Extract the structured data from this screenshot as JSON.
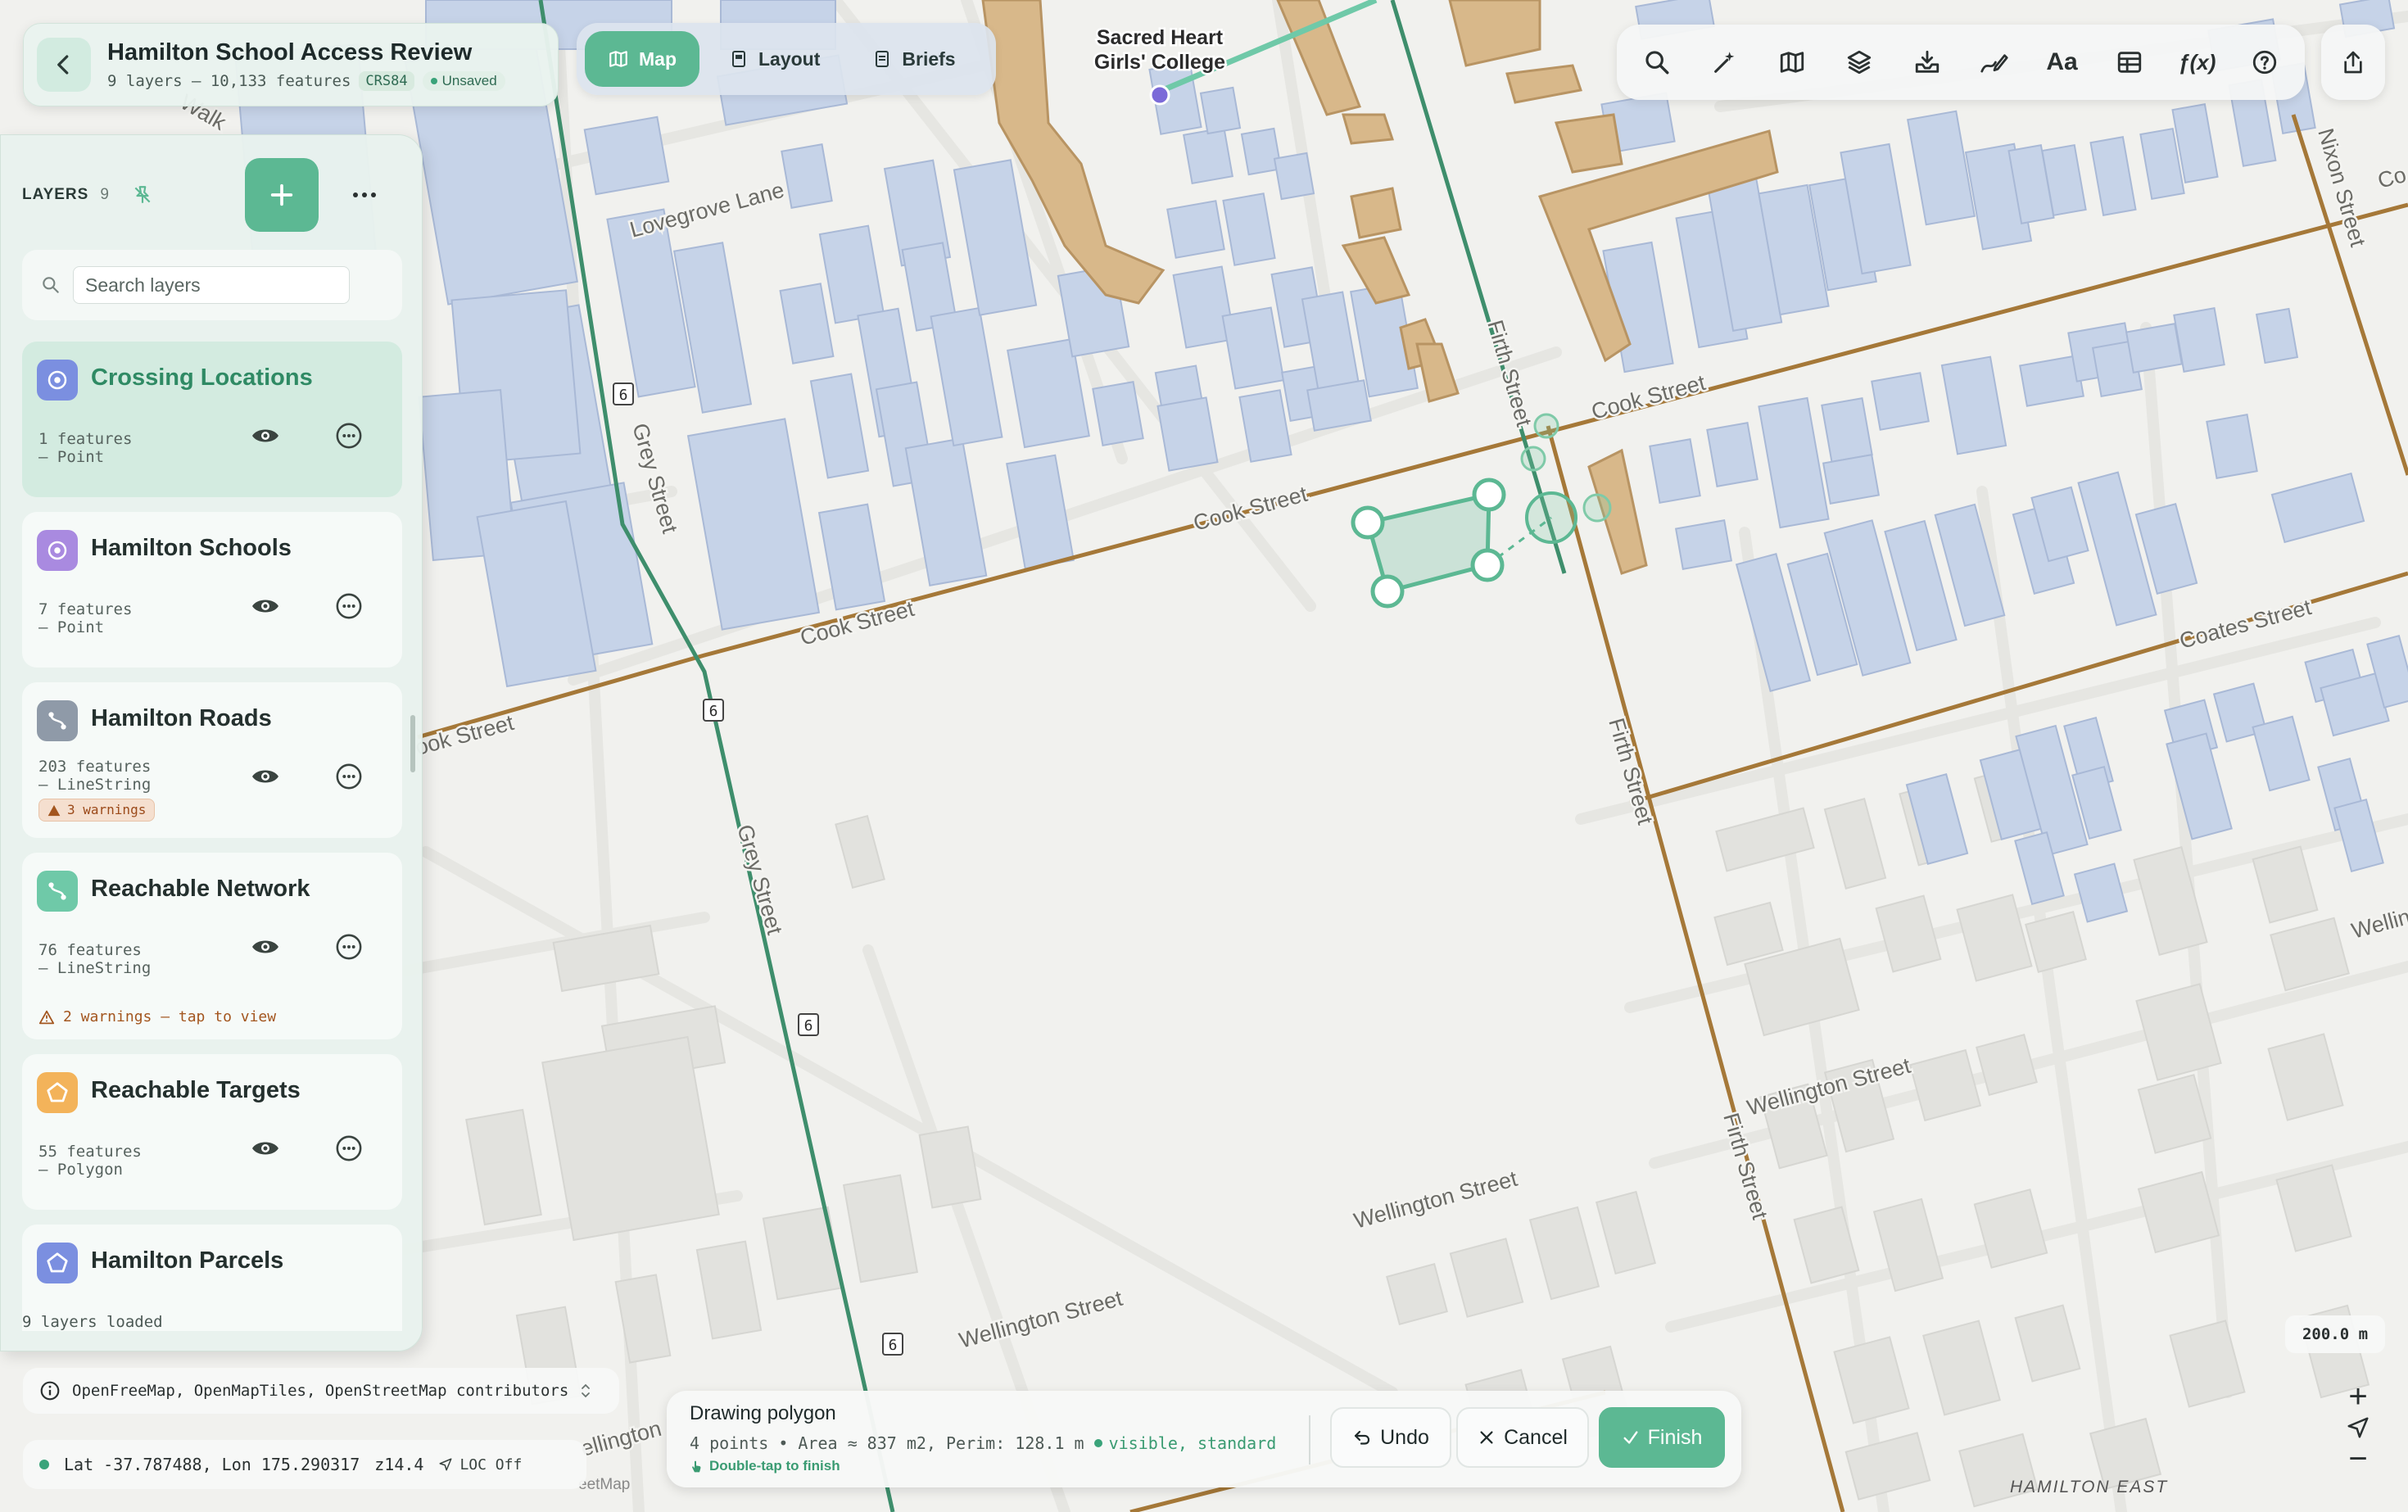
{
  "header": {
    "title": "Hamilton School Access Review",
    "subtitle": "9 layers — 10,133 features",
    "crs": "CRS84",
    "save_status": "Unsaved"
  },
  "view_tabs": [
    {
      "label": "Map",
      "icon": "map-icon",
      "active": true
    },
    {
      "label": "Layout",
      "icon": "layout-icon",
      "active": false
    },
    {
      "label": "Briefs",
      "icon": "briefs-icon",
      "active": false
    }
  ],
  "toolbar": {
    "buttons": [
      "search-icon",
      "magic-wand-icon",
      "basemap-icon",
      "layers-icon",
      "import-icon",
      "draw-icon",
      "text-icon",
      "table-icon",
      "function-icon",
      "help-icon"
    ],
    "text_label": "Aa",
    "function_label": "ƒ(x)"
  },
  "layers_panel": {
    "title": "LAYERS",
    "count": "9",
    "search_placeholder": "Search layers",
    "footer": "9 layers loaded",
    "layers": [
      {
        "name": "Crossing Locations",
        "features": "1 features",
        "geometry": "– Point",
        "color": "#7b8fe0",
        "icon": "point-icon",
        "active": true
      },
      {
        "name": "Hamilton Schools",
        "features": "7 features",
        "geometry": "– Point",
        "color": "#a98ae0",
        "icon": "point-icon",
        "active": false
      },
      {
        "name": "Hamilton Roads",
        "features": "203 features",
        "geometry": "– LineString",
        "color": "#8f9aa8",
        "icon": "line-icon",
        "warning_badge": "3 warnings",
        "active": false
      },
      {
        "name": "Reachable Network",
        "features": "76 features",
        "geometry": "– LineString",
        "color": "#6fc9a8",
        "icon": "line-icon",
        "warning_note": "2 warnings — tap to view",
        "active": false
      },
      {
        "name": "Reachable Targets",
        "features": "55 features",
        "geometry": "– Polygon",
        "color": "#f3b35a",
        "icon": "polygon-icon",
        "active": false
      },
      {
        "name": "Hamilton Parcels",
        "features": "",
        "geometry": "",
        "color": "#7b8fe0",
        "icon": "polygon-icon",
        "active": false
      }
    ]
  },
  "attribution": "OpenFreeMap, OpenMapTiles, OpenStreetMap contributors",
  "status_bar": {
    "coordinates": "Lat -37.787488, Lon 175.290317",
    "zoom": "z14.4",
    "location": "LOC Off"
  },
  "drawing": {
    "title": "Drawing polygon",
    "points": "4 points",
    "measure": "Area ≈ 837 m2, Perim: 128.1 m",
    "visibility": "visible, standard",
    "hint": "Double-tap to finish",
    "undo_label": "Undo",
    "cancel_label": "Cancel",
    "finish_label": "Finish"
  },
  "map": {
    "scale": "200.0 m",
    "zoom_in": "+",
    "zoom_out": "−",
    "poi": [
      "Sacred Heart",
      "Girls' College"
    ],
    "district": "HAMILTON EAST",
    "streets": {
      "grey": "Grey Street",
      "cook": "Cook Street",
      "cook_partial": "ook Street",
      "firth": "Firth Street",
      "wellington": "Wellington Street",
      "wellington_partial": "Wellin",
      "wellington_left": "ellington",
      "lovegrove": "Lovegrove Lane",
      "coates": "Coates Street",
      "nixon": "Nixon Street",
      "walk": "Walk",
      "partial_right": "Co",
      "route_number": "6"
    },
    "colors": {
      "school_building": "#d8b88a",
      "building": "#c6d3e8",
      "land_building": "#e2e2de",
      "road_brown": "#a57838",
      "road_green": "#3e8e6c",
      "drawing": "#5cb893"
    }
  }
}
